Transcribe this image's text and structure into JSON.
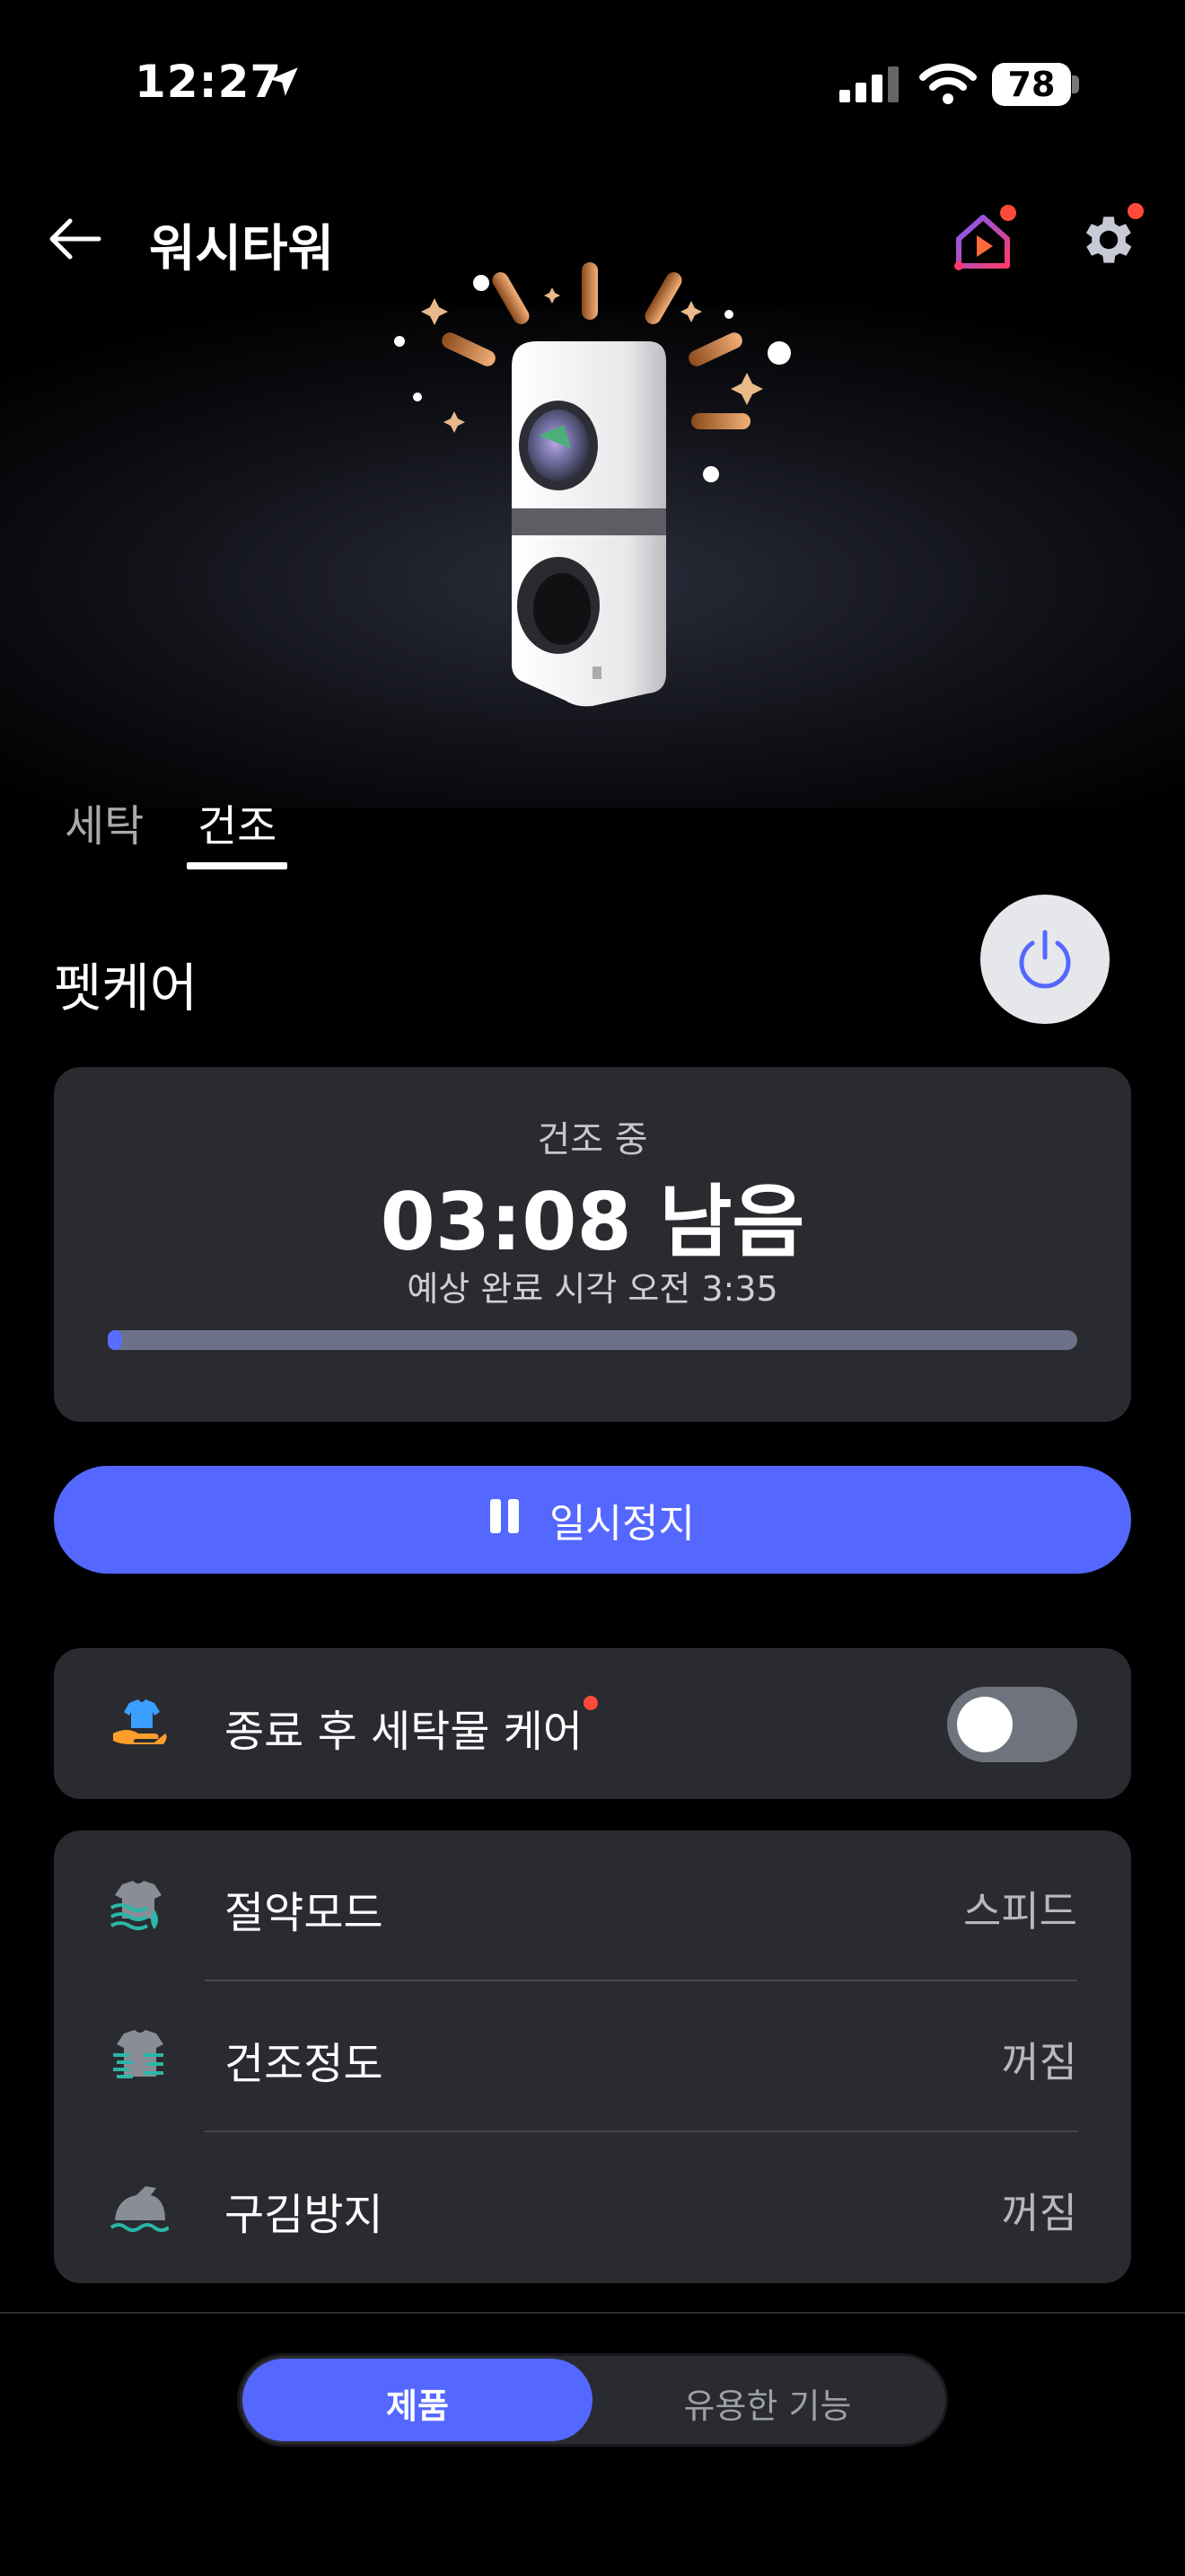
{
  "status_bar": {
    "time": "12:27",
    "battery": "78"
  },
  "header": {
    "title": "워시타워"
  },
  "tabs": [
    {
      "label": "세탁",
      "active": false
    },
    {
      "label": "건조",
      "active": true
    }
  ],
  "course": {
    "name": "펫케어"
  },
  "status": {
    "label": "건조 중",
    "remaining": "03:08 남음",
    "eta": "예상 완료 시각 오전 3:35",
    "progress_fraction": 0.01
  },
  "pause_button": {
    "label": "일시정지"
  },
  "care": {
    "label": "종료 후 세탁물 케어",
    "enabled": false
  },
  "settings": [
    {
      "label": "절약모드",
      "value": "스피드",
      "icon": "eco-mode-icon"
    },
    {
      "label": "건조정도",
      "value": "꺼짐",
      "icon": "dry-level-icon"
    },
    {
      "label": "구김방지",
      "value": "꺼짐",
      "icon": "wrinkle-care-icon"
    }
  ],
  "bottom_tabs": [
    {
      "label": "제품",
      "active": true
    },
    {
      "label": "유용한 기능",
      "active": false
    }
  ],
  "colors": {
    "accent": "#5468ff",
    "card": "#2a2b30",
    "notification_dot": "#ff4a3a"
  }
}
